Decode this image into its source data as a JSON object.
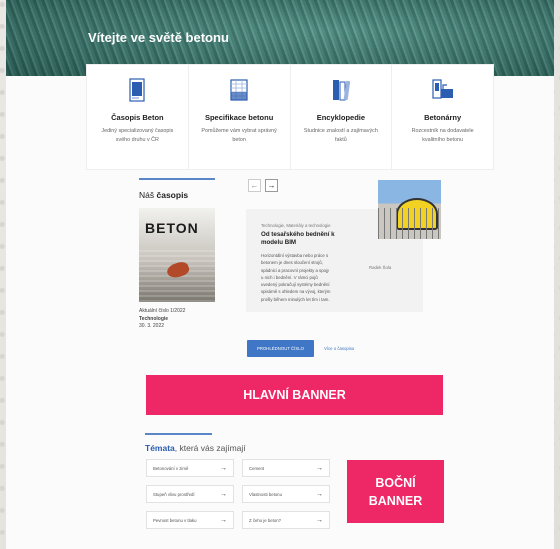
{
  "hero": {
    "title": "Vítejte ve světě betonu"
  },
  "cards": [
    {
      "icon": "magazine-icon",
      "title": "Časopis Beton",
      "text": "Jediný specializovaný časopis svého druhu v ČR"
    },
    {
      "icon": "building-icon",
      "title": "Specifikace betonu",
      "text": "Pomůžeme vám vybrat správný beton"
    },
    {
      "icon": "books-icon",
      "title": "Encyklopedie",
      "text": "Studnice znalostí a zajímavých faktů"
    },
    {
      "icon": "plant-icon",
      "title": "Betonárny",
      "text": "Rozcestník na dodavatele kvalitního betonu"
    }
  ],
  "magazine": {
    "heading_prefix": "Náš",
    "heading_bold": "časopis",
    "cover_title": "BETON",
    "issue": "Aktuální číslo 1/2022",
    "category": "Technologie",
    "date": "30. 3. 2022"
  },
  "article": {
    "category": "Technologie, Materiály a technologie",
    "title": "Od tesařského bednění k modelu BIM",
    "body": "Horizontální výstavba nebo práce s betonem je dnes sloučení strojů, spádnici a pracovní projekty a spojy u nich i bednění. V rámci pojů uvedený pokračují systémy bednění spisárně s ohledem na vývoj, kterým prošly během minulých let tím i tam.",
    "author": "Radek Šola"
  },
  "buttons": {
    "primary": "PROHLÉDNOUT ČÍSLO",
    "secondary": "Více o časopisu"
  },
  "banners": {
    "main": "HLAVNÍ BANNER",
    "side_line1": "BOČNÍ",
    "side_line2": "BANNER"
  },
  "topics": {
    "title_bold": "Témata",
    "title_rest": ", která vás zajímají",
    "items": [
      "Betonování v zimě",
      "Cement",
      "Stupeň vlivu prostředí",
      "Vlastnosti betonu",
      "Pevnost betonu v tlaku",
      "Z čeho je beton?"
    ],
    "arrow": "→"
  },
  "carousel": {
    "prev": "←",
    "next": "→"
  }
}
